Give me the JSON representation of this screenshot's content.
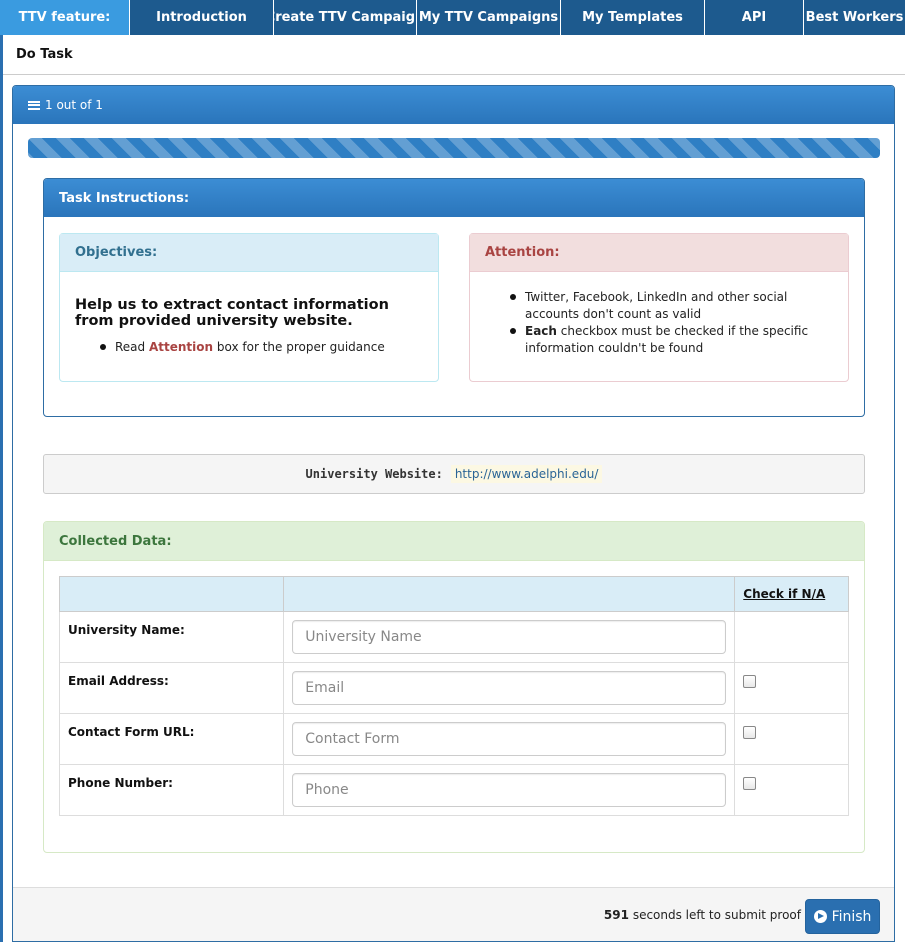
{
  "topnav": {
    "tabs": [
      {
        "label": "TTV feature:",
        "active": true
      },
      {
        "label": "Introduction"
      },
      {
        "label": "Create TTV Campaign"
      },
      {
        "label": "My TTV Campaigns"
      },
      {
        "label": "My Templates"
      },
      {
        "label": "API"
      },
      {
        "label": "Best Workers"
      }
    ]
  },
  "subnav": {
    "title": "Do Task"
  },
  "task_panel": {
    "counter": "1 out of 1",
    "progress_percent": 100
  },
  "instructions": {
    "title": "Task Instructions:",
    "objectives": {
      "title": "Objectives:",
      "headline": "Help us to extract contact information from provided university website.",
      "item_prefix": "Read",
      "item_highlight": "Attention",
      "item_suffix": "box for the proper guidance"
    },
    "attention": {
      "title": "Attention:",
      "item1": "Twitter, Facebook, LinkedIn and other social accounts don't count as valid",
      "item2_bold": "Each",
      "item2_rest": "checkbox must be checked if the specific information couldn't be found"
    }
  },
  "website": {
    "label": "University Website:",
    "url": "http://www.adelphi.edu/"
  },
  "collected": {
    "title": "Collected Data:",
    "na_header": "Check if N/A",
    "rows": [
      {
        "label": "University Name:",
        "placeholder": "University Name",
        "has_checkbox": false
      },
      {
        "label": "Email Address:",
        "placeholder": "Email",
        "has_checkbox": true
      },
      {
        "label": "Contact Form URL:",
        "placeholder": "Contact Form",
        "has_checkbox": true
      },
      {
        "label": "Phone Number:",
        "placeholder": "Phone",
        "has_checkbox": true
      }
    ]
  },
  "footer": {
    "seconds_left": "591",
    "timer_text": "seconds left to submit proof",
    "finish_label": "Finish"
  },
  "colors": {
    "nav_dark": "#1d5a8e",
    "nav_active": "#3a9be0",
    "primary": "#2a75bb",
    "attention_red": "#a94442",
    "success_green": "#3c763d"
  }
}
